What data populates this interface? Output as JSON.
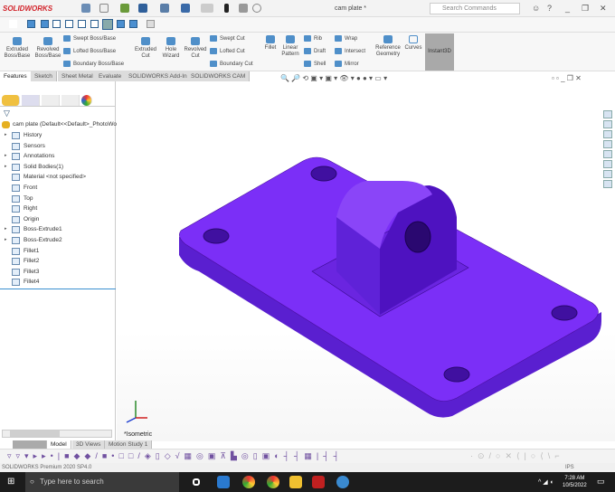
{
  "app": {
    "logo": "SOLIDWORKS",
    "title": "cam plate *",
    "search_placeholder": "Search Commands"
  },
  "ribbon": {
    "large": [
      {
        "label": "Extruded\nBoss/Base"
      },
      {
        "label": "Revolved\nBoss/Base"
      },
      {
        "label": "Extruded\nCut"
      },
      {
        "label": "Hole\nWizard"
      },
      {
        "label": "Revolved\nCut"
      },
      {
        "label": "Fillet"
      },
      {
        "label": "Linear\nPattern"
      },
      {
        "label": "Reference\nGeometry"
      },
      {
        "label": "Curves"
      }
    ],
    "small": [
      "Swept Boss/Base",
      "Lofted Boss/Base",
      "Boundary Boss/Base",
      "Swept Cut",
      "Lofted Cut",
      "Boundary Cut",
      "Rib",
      "Draft",
      "Shell",
      "Wrap",
      "Intersect",
      "Mirror"
    ],
    "instant3d": "Instant3D"
  },
  "tabs": [
    "Features",
    "Sketch",
    "Sheet Metal",
    "Evaluate",
    "SOLIDWORKS Add-Ins",
    "SOLIDWORKS CAM"
  ],
  "tree": {
    "root": "cam plate  (Default<<Default>_PhotoWo",
    "items": [
      {
        "label": "History",
        "exp": true
      },
      {
        "label": "Sensors",
        "exp": false
      },
      {
        "label": "Annotations",
        "exp": true
      },
      {
        "label": "Solid Bodies(1)",
        "exp": true
      },
      {
        "label": "Material <not specified>",
        "exp": false
      },
      {
        "label": "Front",
        "exp": false
      },
      {
        "label": "Top",
        "exp": false
      },
      {
        "label": "Right",
        "exp": false
      },
      {
        "label": "Origin",
        "exp": false
      },
      {
        "label": "Boss-Extrude1",
        "exp": true
      },
      {
        "label": "Boss-Extrude2",
        "exp": true
      },
      {
        "label": "Fillet1",
        "exp": false
      },
      {
        "label": "Fillet2",
        "exp": false
      },
      {
        "label": "Fillet3",
        "exp": false
      },
      {
        "label": "Fillet4",
        "exp": false
      }
    ]
  },
  "viewport": {
    "view_name": "*Isometric",
    "model_color": "#7b2ff7"
  },
  "bottom_tabs": [
    "Model",
    "3D Views",
    "Motion Study 1"
  ],
  "status": {
    "product": "SOLIDWORKS Premium 2020 SP4.0",
    "units": "IPS"
  },
  "taskbar": {
    "search": "Type here to search",
    "time": "7:28 AM",
    "date": "10/5/2022"
  }
}
